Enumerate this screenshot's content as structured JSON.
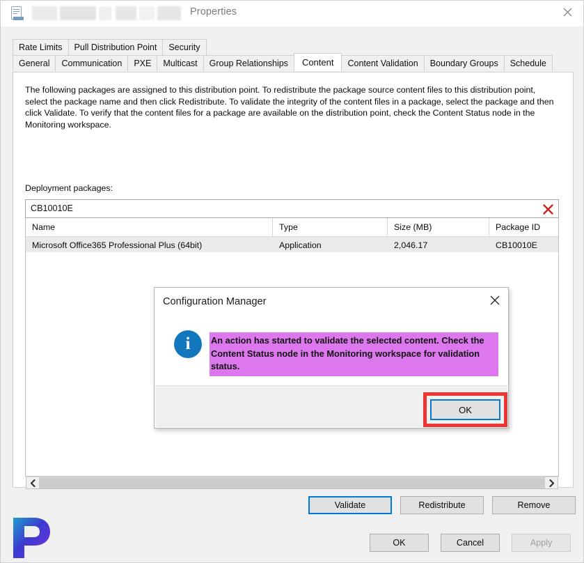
{
  "window": {
    "title": "Properties",
    "icon": "properties-document-icon",
    "close_label": "✕",
    "redacted_title_prefix": true
  },
  "tabs": {
    "row1": [
      {
        "label": "Rate Limits",
        "selected": false
      },
      {
        "label": "Pull Distribution Point",
        "selected": false
      },
      {
        "label": "Security",
        "selected": false
      }
    ],
    "row2": [
      {
        "label": "General",
        "selected": false
      },
      {
        "label": "Communication",
        "selected": false
      },
      {
        "label": "PXE",
        "selected": false
      },
      {
        "label": "Multicast",
        "selected": false
      },
      {
        "label": "Group Relationships",
        "selected": false
      },
      {
        "label": "Content",
        "selected": true
      },
      {
        "label": "Content Validation",
        "selected": false
      },
      {
        "label": "Boundary Groups",
        "selected": false
      },
      {
        "label": "Schedule",
        "selected": false
      }
    ]
  },
  "content": {
    "description": "The following packages are assigned to this distribution point. To redistribute the package source content files to this distribution point, select the package name and then click Redistribute. To validate the integrity of the content files in a package, select the package and then click Validate. To verify that the content files for a package are available on the distribution point, check the Content Status node in the Monitoring workspace.",
    "packages_label": "Deployment packages:",
    "search": {
      "value": "CB10010E",
      "placeholder": "",
      "clear_icon": "red-x-clear-icon"
    },
    "table": {
      "columns": [
        "Name",
        "Type",
        "Size (MB)",
        "Package ID"
      ],
      "rows": [
        {
          "name": "Microsoft Office365 Professional Plus (64bit)",
          "type": "Application",
          "size": "2,046.17",
          "package_id": "CB10010E",
          "selected": true
        }
      ]
    },
    "scrollbar": {
      "left_arrow": "‹",
      "right_arrow": "›"
    },
    "actions": [
      {
        "label": "Validate",
        "focused": true,
        "disabled": false
      },
      {
        "label": "Redistribute",
        "focused": false,
        "disabled": false
      },
      {
        "label": "Remove",
        "focused": false,
        "disabled": false
      }
    ]
  },
  "footer_buttons": [
    {
      "label": "OK",
      "disabled": false
    },
    {
      "label": "Cancel",
      "disabled": false
    },
    {
      "label": "Apply",
      "disabled": true
    }
  ],
  "dialog": {
    "title": "Configuration Manager",
    "close_label": "✕",
    "icon": "info-circle-icon",
    "message": "An action has started to validate the selected content. Check the Content Status node in the Monitoring workspace for validation status.",
    "highlight_color": "#dd77ee",
    "ok_label": "OK",
    "annotation_color": "#ee3333",
    "focus_color": "#0078d7"
  },
  "watermark": {
    "letter": "P",
    "colors": [
      "#1f9ed0",
      "#3b3bd0",
      "#7b2fe0"
    ]
  }
}
